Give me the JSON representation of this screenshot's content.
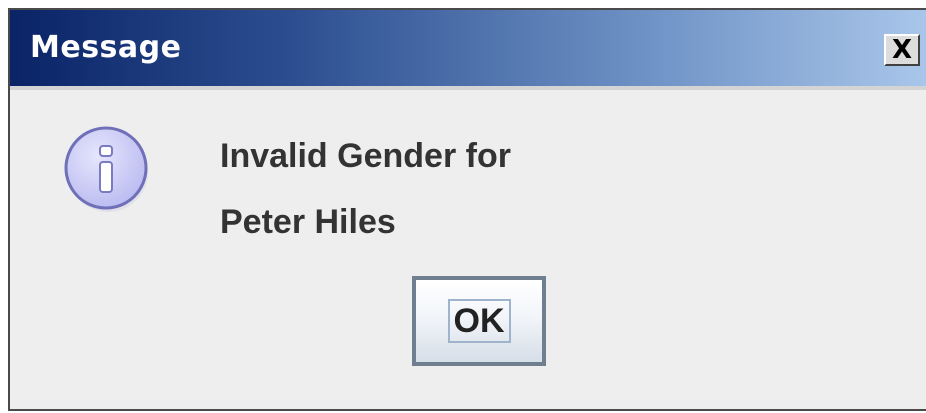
{
  "window": {
    "title": "Message",
    "close_label": "X"
  },
  "icon": {
    "name": "information-icon",
    "glyph": "i",
    "fill": "#c9caf5",
    "stroke": "#6f70b8"
  },
  "message": {
    "line1": "Invalid Gender for",
    "line2": "Peter Hiles"
  },
  "buttons": {
    "ok_label": "OK"
  },
  "colors": {
    "titlebar_start": "#0a2466",
    "titlebar_end": "#a9c6ea",
    "body_bg": "#eeeeee"
  }
}
